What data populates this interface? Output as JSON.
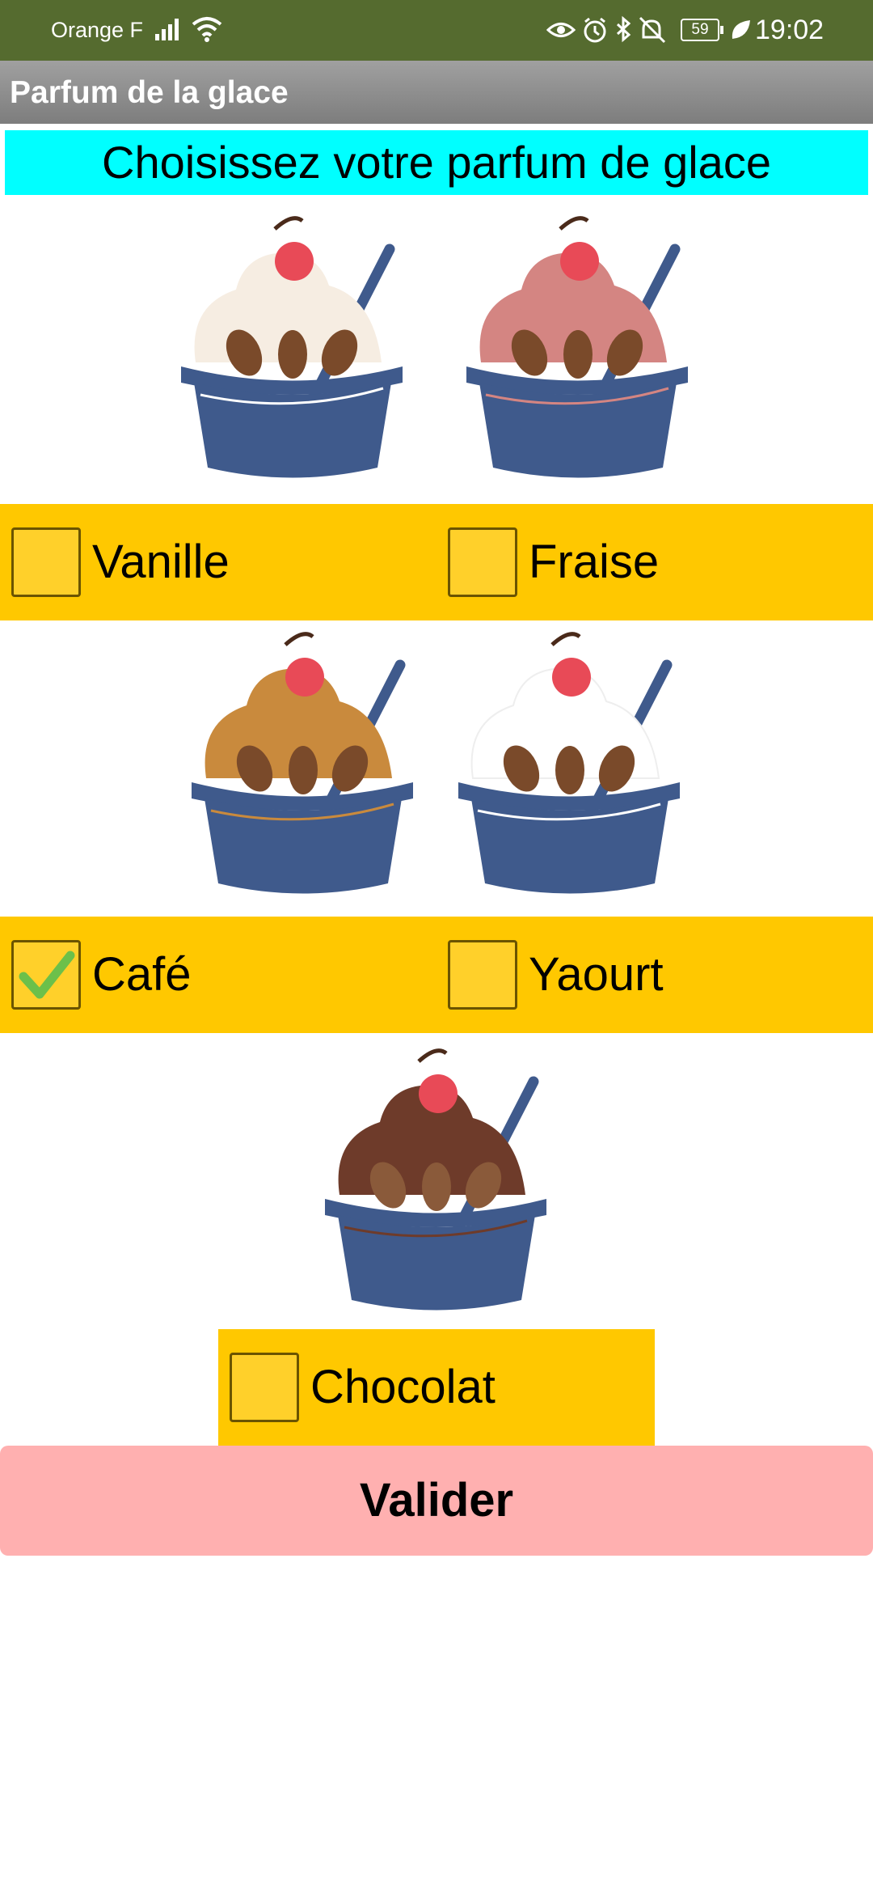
{
  "status_bar": {
    "carrier": "Orange F",
    "battery": "59",
    "time": "19:02",
    "icons": [
      "signal-icon",
      "wifi-icon",
      "eye-icon",
      "alarm-icon",
      "bluetooth-icon",
      "mute-icon",
      "battery-icon",
      "leaf-icon"
    ]
  },
  "app": {
    "title": "Parfum de la glace",
    "prompt": "Choisissez votre parfum de glace"
  },
  "flavors": [
    {
      "label": "Vanille",
      "checked": false,
      "cream_color": "#f6ede2"
    },
    {
      "label": "Fraise",
      "checked": false,
      "cream_color": "#d48582"
    },
    {
      "label": "Café",
      "checked": true,
      "cream_color": "#c98a3d"
    },
    {
      "label": "Yaourt",
      "checked": false,
      "cream_color": "#ffffff"
    },
    {
      "label": "Chocolat",
      "checked": false,
      "cream_color": "#6e3b2a"
    }
  ],
  "validate_label": "Valider",
  "colors": {
    "status_bar": "#556b2f",
    "header_bg": "#00ffff",
    "option_bg": "#ffc800",
    "button_bg": "#ffb0b0",
    "cup": "#3f5a8c",
    "cherry": "#e84a57"
  }
}
